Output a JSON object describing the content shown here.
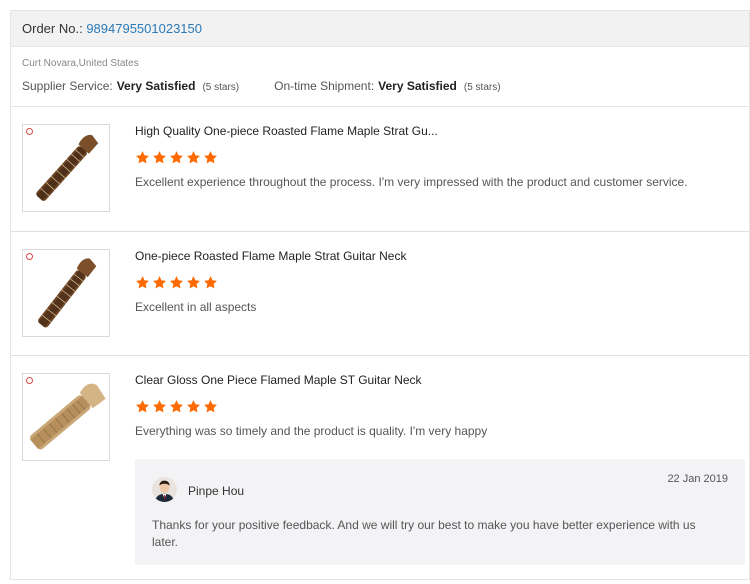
{
  "order": {
    "label": "Order No.:",
    "number": "9894795501023150"
  },
  "buyer": {
    "location": "Curt Novara,United States"
  },
  "ratings": [
    {
      "label": "Supplier Service:",
      "value": "Very Satisfied",
      "stars": "(5 stars)"
    },
    {
      "label": "On-time Shipment:",
      "value": "Very Satisfied",
      "stars": "(5 stars)"
    }
  ],
  "reviews": [
    {
      "title": "High Quality One-piece Roasted Flame Maple Strat Gu...",
      "rating": 5,
      "text": "Excellent experience throughout the process.  I'm very impressed with the product and customer service.",
      "thumb_icon": "guitar-neck-icon"
    },
    {
      "title": "One-piece Roasted Flame Maple Strat Guitar Neck",
      "rating": 5,
      "text": "Excellent in all aspects",
      "thumb_icon": "guitar-neck-icon"
    },
    {
      "title": "Clear Gloss One Piece Flamed Maple ST Guitar Neck",
      "rating": 5,
      "text": "Everything was so timely and the product is quality. I'm very happy",
      "thumb_icon": "guitar-neck-icon"
    }
  ],
  "reply": {
    "name": "Pinpe Hou",
    "date": "22 Jan 2019",
    "text": "Thanks for your positive feedback. And we will try our best to make you have better experience with us later."
  },
  "colors": {
    "star": "#ff6a00",
    "link": "#2a7ab8",
    "header_bg": "#f2f2f2",
    "reply_bg": "#f3f3f6"
  }
}
